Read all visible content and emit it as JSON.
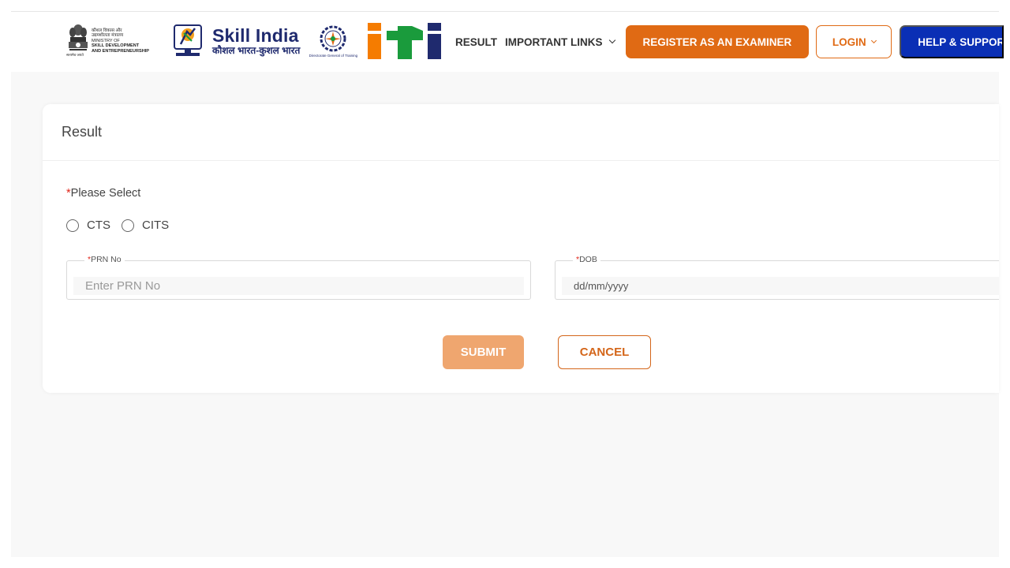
{
  "header": {
    "ministry": {
      "hindi_line1": "कौशल विकास और",
      "hindi_line2": "उद्यमशीलता मंत्रालय",
      "line1": "MINISTRY OF",
      "line2": "SKILL DEVELOPMENT",
      "line3": "AND ENTREPRENEURSHIP",
      "motto": "सत्यमेव जयते"
    },
    "skill_india": {
      "title": "Skill India",
      "subtitle": "कौशल भारत-कुशल भारत"
    },
    "dgt_caption": "Directorate General of Training",
    "nav": {
      "result": "RESULT",
      "important_links": "IMPORTANT LINKS",
      "register": "REGISTER AS AN EXAMINER",
      "login": "LOGIN",
      "help": "HELP & SUPPORT"
    },
    "colors": {
      "accent_orange": "#e06a14",
      "help_blue": "#0a2fb5",
      "iti_orange": "#f57c00",
      "iti_green": "#1a9b3c",
      "iti_navy": "#1f2a6e"
    }
  },
  "card": {
    "title": "Result",
    "select_required": "*",
    "select_label": "Please Select",
    "options": [
      "CTS",
      "CITS"
    ],
    "prn": {
      "required": "*",
      "label": "PRN No",
      "placeholder": "Enter PRN No"
    },
    "dob": {
      "required": "*",
      "label": "DOB",
      "placeholder": "dd/mm/yyyy"
    },
    "submit": "SUBMIT",
    "cancel": "CANCEL"
  }
}
